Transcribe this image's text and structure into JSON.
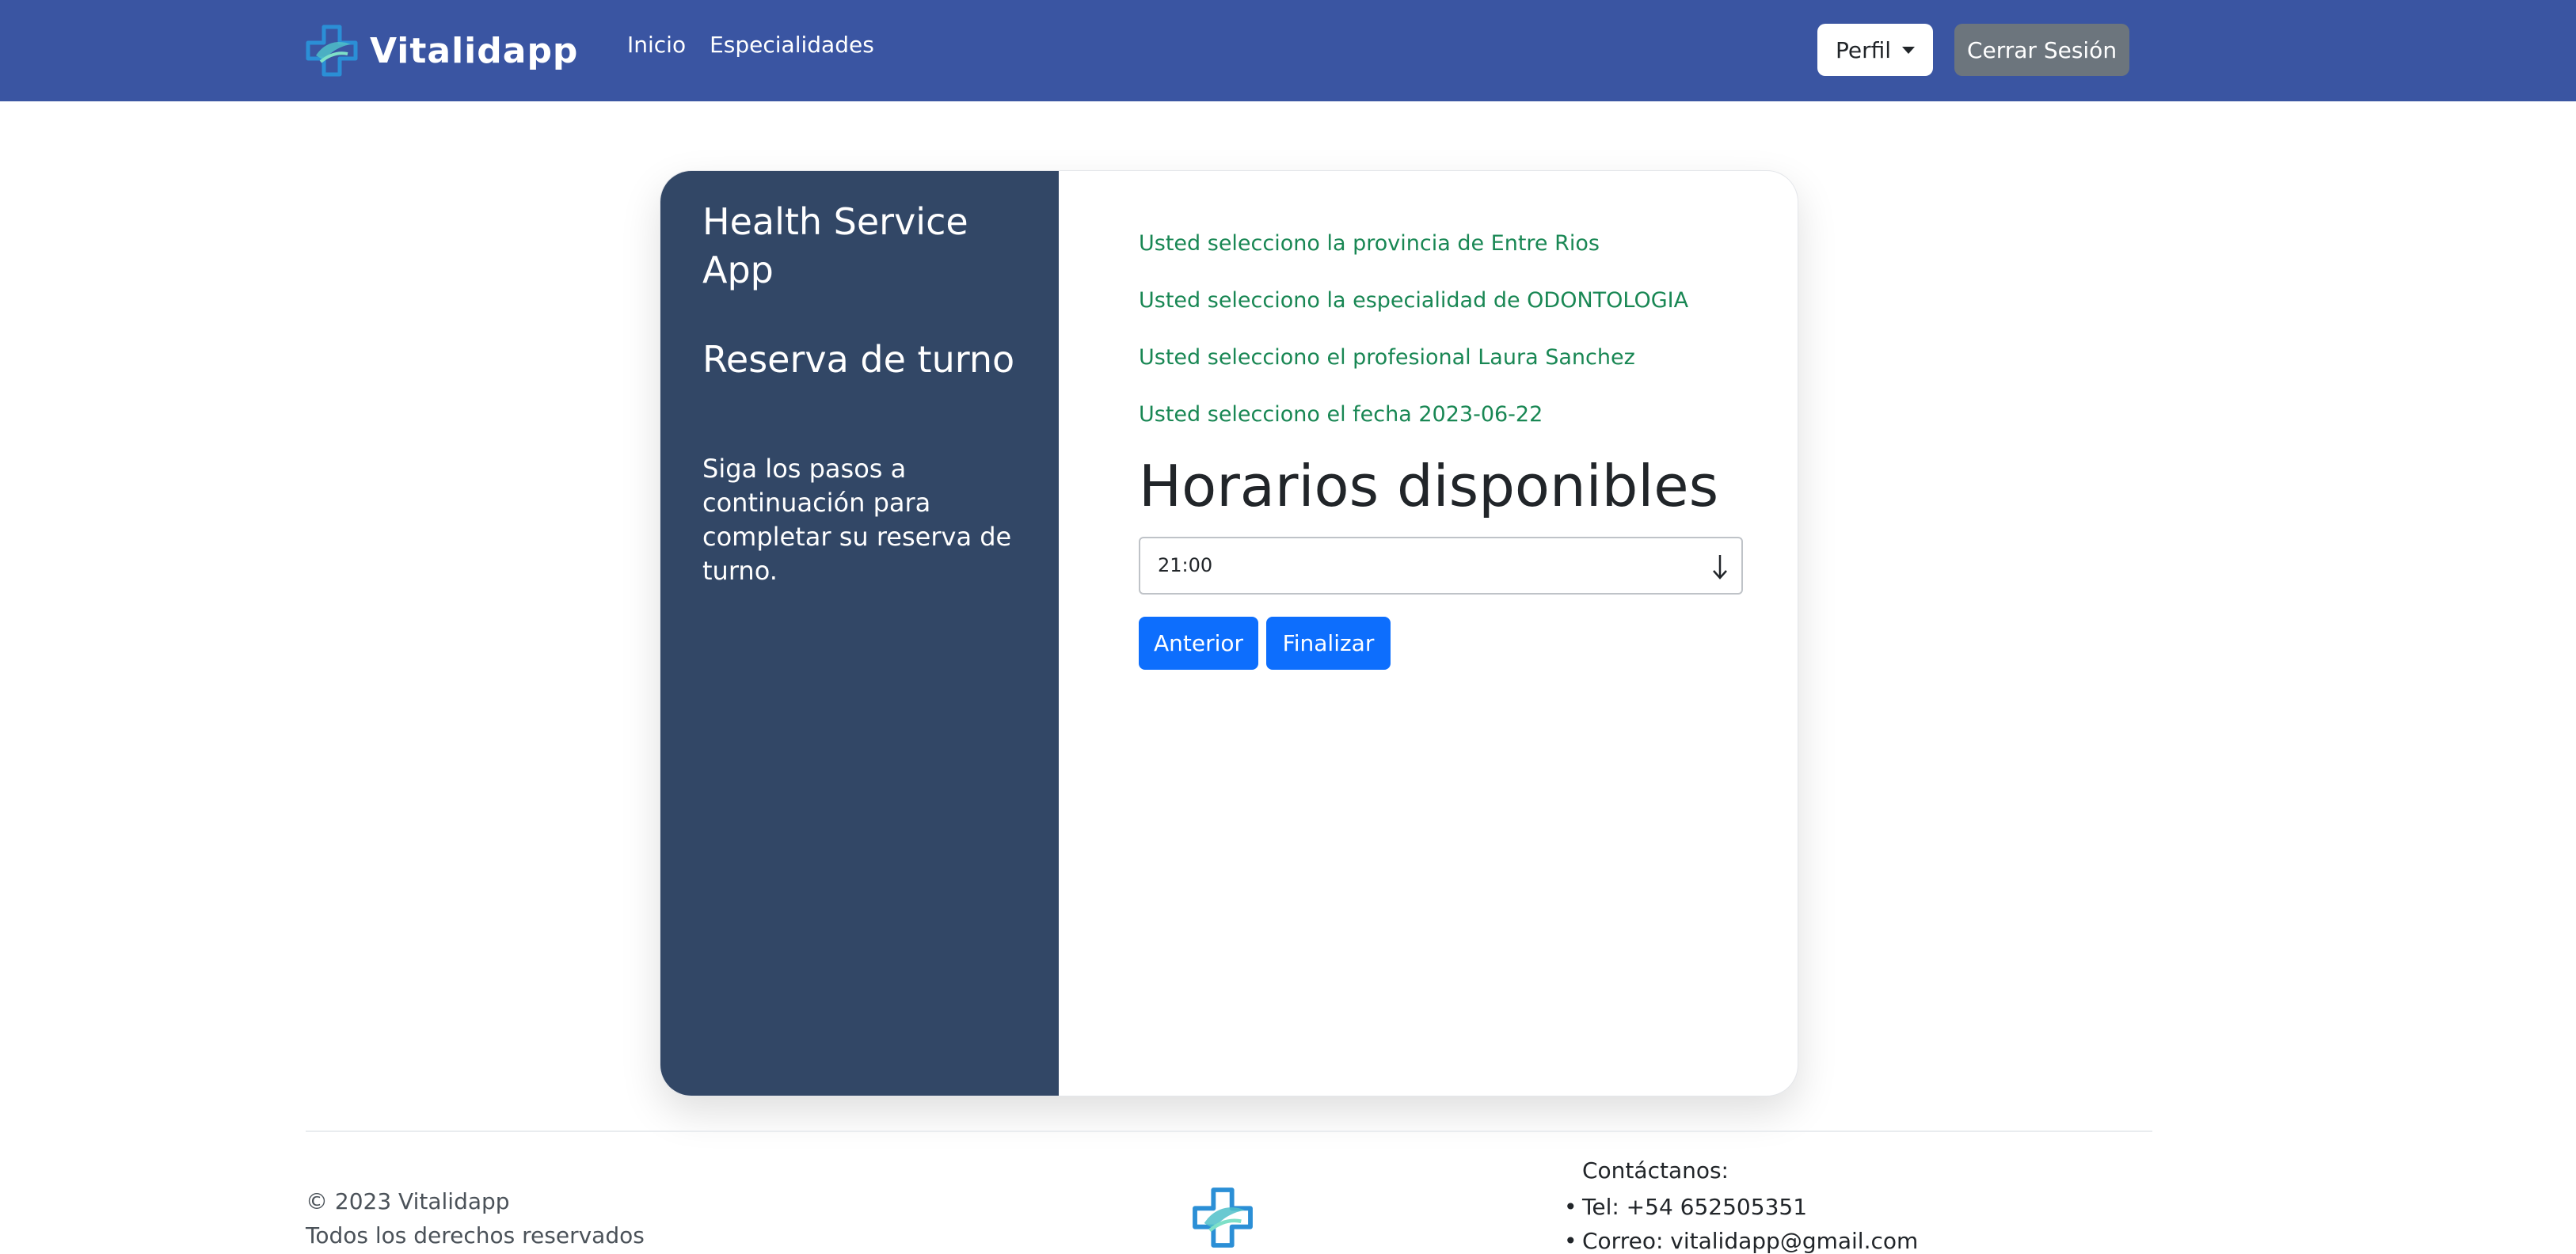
{
  "navbar": {
    "brand_name": "Vitalidapp",
    "links": [
      "Inicio",
      "Especialidades"
    ],
    "profile_label": "Perfil",
    "logout_label": "Cerrar Sesión",
    "color": "#3a55a2"
  },
  "sidebar": {
    "app_title": "Health Service App",
    "section_title": "Reserva de turno",
    "instructions": "Siga los pasos a continuación para completar su reserva de turno.",
    "color": "#324766"
  },
  "summary": [
    "Usted selecciono la provincia de Entre Rios",
    "Usted selecciono la especialidad de ODONTOLOGIA",
    "Usted selecciono el profesional Laura Sanchez",
    "Usted selecciono el fecha 2023-06-22"
  ],
  "horarios": {
    "title": "Horarios disponibles",
    "selected": "21:00",
    "select_icon": "arrow-down-icon"
  },
  "actions": {
    "back_label": "Anterior",
    "finish_label": "Finalizar",
    "primary_color": "#0d6efd"
  },
  "footer": {
    "copyright": "© 2023 Vitalidapp",
    "rights": "Todos los derechos reservados",
    "contact_title": "Contáctanos:",
    "contacts": [
      "Tel: +54 652505351",
      "Correo: vitalidapp@gmail.com"
    ]
  }
}
